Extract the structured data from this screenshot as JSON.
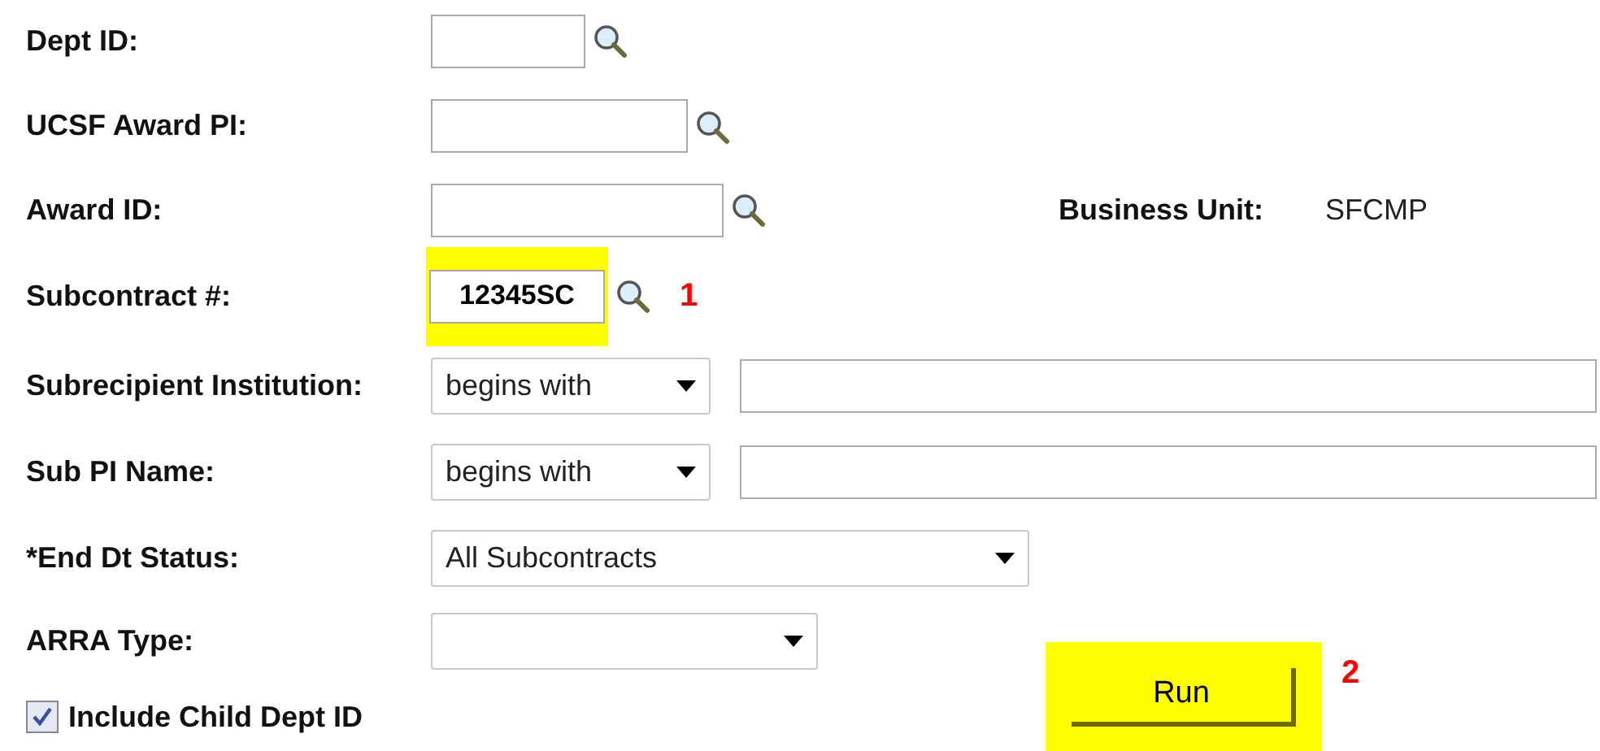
{
  "fields": [
    {
      "kind": "lookup",
      "label": "Dept ID:",
      "highlighted": false
    },
    {
      "kind": "lookup",
      "label": "UCSF Award PI:",
      "highlighted": false
    },
    {
      "kind": "lookup",
      "label": "Award ID:",
      "highlighted": false,
      "side_label": "Business Unit:",
      "side_value": "SFCMP"
    },
    {
      "kind": "lookup",
      "label": "Subcontract #:",
      "value": "12345SC",
      "highlighted": true,
      "marker": "1"
    },
    {
      "kind": "operator_text",
      "label": "Subrecipient Institution:",
      "operator": "begins with"
    },
    {
      "kind": "operator_text",
      "label": "Sub PI Name:",
      "operator": "begins with"
    },
    {
      "kind": "select",
      "label": "*End Dt Status:",
      "value": "All Subcontracts"
    },
    {
      "kind": "select",
      "label": "ARRA Type:"
    }
  ],
  "include_child": {
    "label": "Include Child Dept ID",
    "checked": true
  },
  "run_button": {
    "label": "Run",
    "highlighted": true,
    "marker": "2"
  }
}
